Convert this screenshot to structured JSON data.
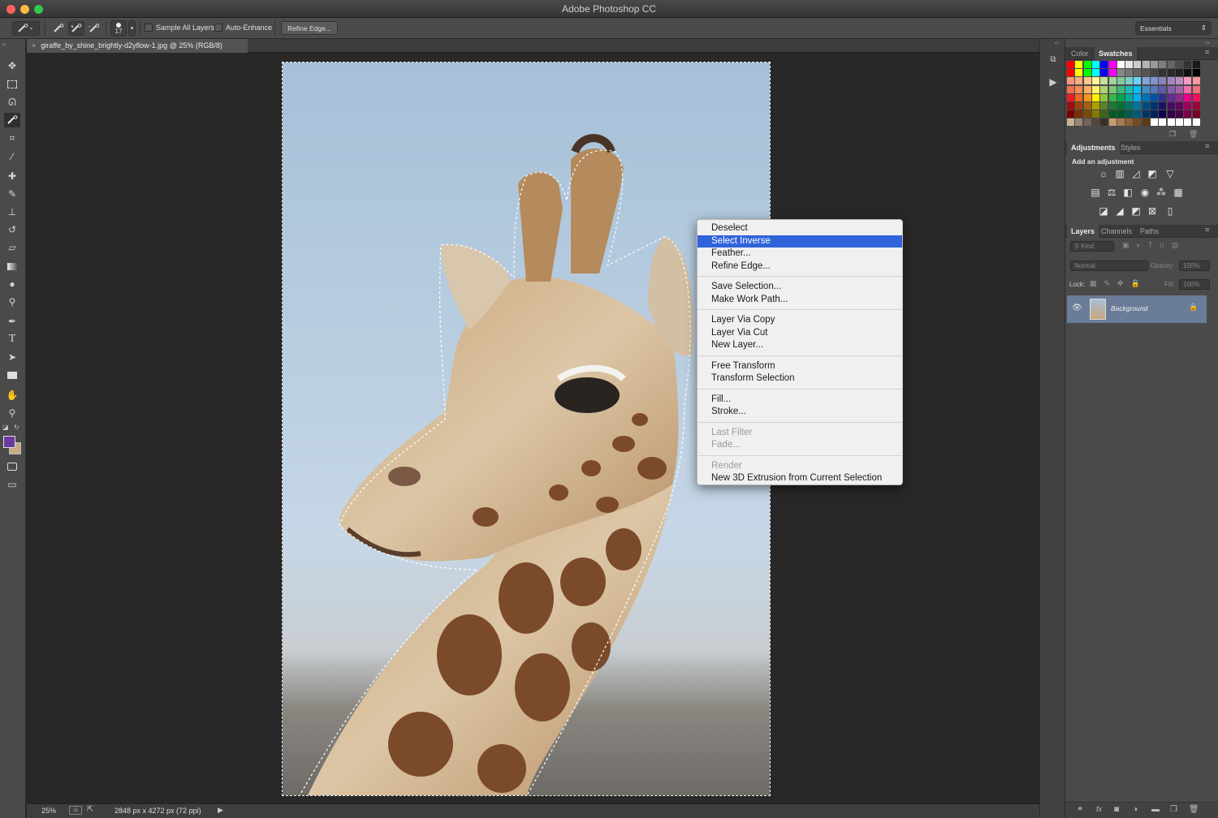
{
  "window": {
    "title": "Adobe Photoshop CC"
  },
  "options_bar": {
    "brush_size": "17",
    "sample_all_layers": "Sample All Layers",
    "auto_enhance": "Auto-Enhance",
    "refine_edge": "Refine Edge...",
    "workspace": "Essentials"
  },
  "document": {
    "tab_label": "giraffe_by_shine_brightly-d2yflow-1.jpg @ 25% (RGB/8)"
  },
  "status": {
    "zoom": "25%",
    "doc_info": "2848 px x 4272 px (72 ppi)"
  },
  "color_panel": {
    "tabs": [
      "Color",
      "Swatches"
    ],
    "active": "Swatches"
  },
  "adjust_panel": {
    "tabs": [
      "Adjustments",
      "Styles"
    ],
    "heading": "Add an adjustment"
  },
  "layers_panel": {
    "tabs": [
      "Layers",
      "Channels",
      "Paths"
    ],
    "filter": "Kind",
    "blend": "Normal",
    "opacity_label": "Opacity:",
    "opacity": "100%",
    "lock_label": "Lock:",
    "fill_label": "Fill:",
    "fill": "100%",
    "layer_name": "Background"
  },
  "colors": {
    "foreground": "#6a3b9c",
    "background": "#c8ad82",
    "menu_highlight": "#2f63d9"
  },
  "context_menu": {
    "groups": [
      [
        {
          "label": "Deselect"
        },
        {
          "label": "Select Inverse",
          "selected": true
        },
        {
          "label": "Feather..."
        },
        {
          "label": "Refine Edge..."
        }
      ],
      [
        {
          "label": "Save Selection..."
        },
        {
          "label": "Make Work Path..."
        }
      ],
      [
        {
          "label": "Layer Via Copy"
        },
        {
          "label": "Layer Via Cut"
        },
        {
          "label": "New Layer..."
        }
      ],
      [
        {
          "label": "Free Transform"
        },
        {
          "label": "Transform Selection"
        }
      ],
      [
        {
          "label": "Fill..."
        },
        {
          "label": "Stroke..."
        }
      ],
      [
        {
          "label": "Last Filter",
          "disabled": true
        },
        {
          "label": "Fade...",
          "disabled": true
        }
      ],
      [
        {
          "label": "Render",
          "disabled": true
        },
        {
          "label": "New 3D Extrusion from Current Selection"
        }
      ]
    ]
  }
}
